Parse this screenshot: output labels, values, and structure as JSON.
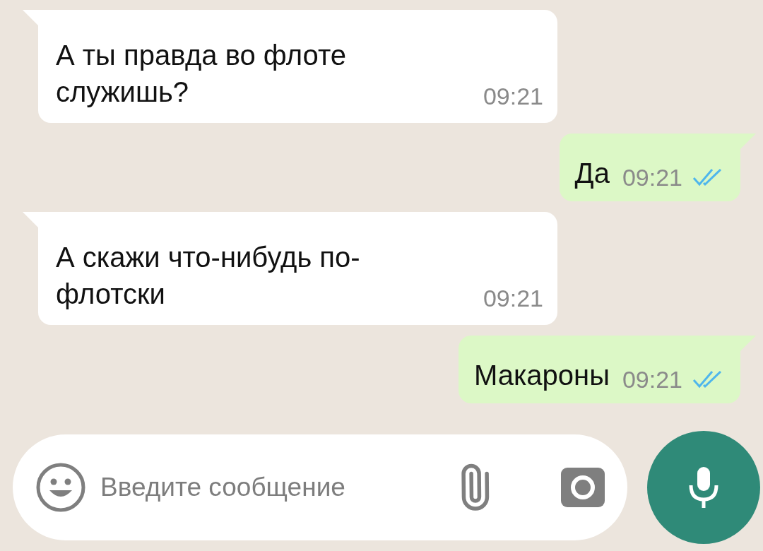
{
  "messages": [
    {
      "kind": "incoming",
      "text": "А ты правда во флоте\nслужишь?",
      "time": "09:21"
    },
    {
      "kind": "outgoing",
      "text": "Да",
      "time": "09:21",
      "read": true
    },
    {
      "kind": "incoming",
      "text": "А скажи что-нибудь по-\nфлотски",
      "time": "09:21"
    },
    {
      "kind": "outgoing",
      "text": "Макароны",
      "time": "09:21",
      "read": true
    }
  ],
  "composer": {
    "placeholder": "Введите сообщение"
  }
}
